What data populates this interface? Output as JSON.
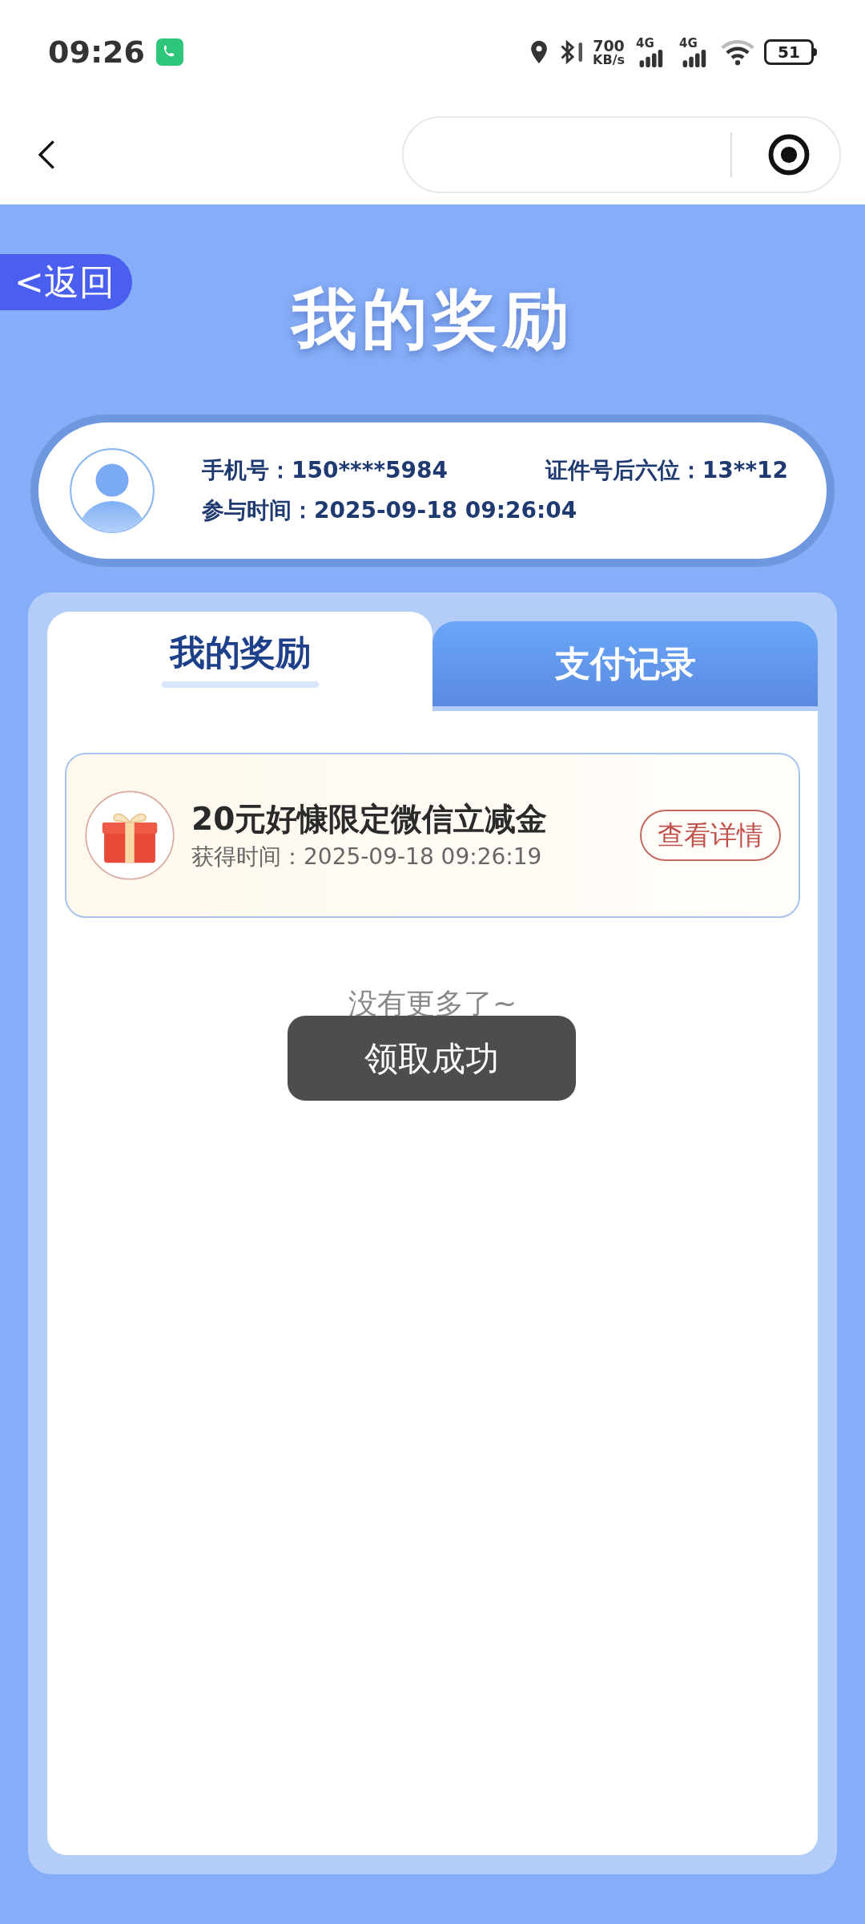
{
  "status_bar": {
    "time": "09:26",
    "speed": "700",
    "speed_unit": "KB/s",
    "networks": [
      "4G",
      "4G"
    ],
    "battery": "51"
  },
  "back_button": "<返回",
  "title": "我的奖励",
  "user": {
    "phone": "手机号：150****5984",
    "id": "证件号后六位：13**12",
    "joined": "参与时间：2025-09-18 09:26:04"
  },
  "tabs": [
    {
      "label": "我的奖励",
      "selected": true
    },
    {
      "label": "支付记录",
      "selected": false
    }
  ],
  "rewards": [
    {
      "name": "20元好慷限定微信立减金",
      "time": "获得时间：2025-09-18 09:26:19",
      "action": "查看详情"
    }
  ],
  "end_note": "没有更多了~",
  "toast": "领取成功"
}
